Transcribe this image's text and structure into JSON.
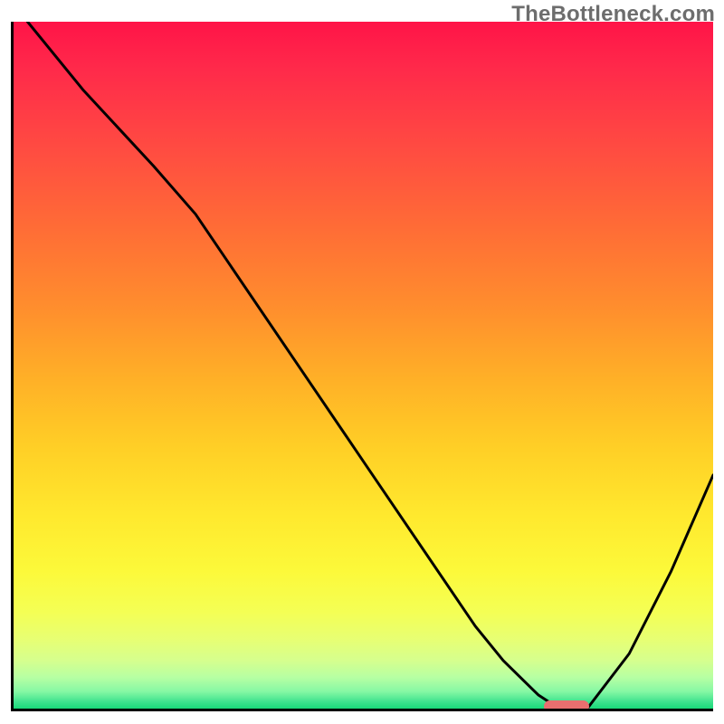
{
  "watermark": "TheBottleneck.com",
  "chart_data": {
    "type": "line",
    "title": "",
    "xlabel": "",
    "ylabel": "",
    "xlim": [
      0,
      100
    ],
    "ylim": [
      0,
      100
    ],
    "grid": false,
    "legend": false,
    "series": [
      {
        "name": "bottleneck-curve",
        "x": [
          2,
          10,
          20,
          26,
          30,
          40,
          50,
          60,
          66,
          70,
          75,
          78,
          82,
          88,
          94,
          100
        ],
        "y": [
          100,
          90,
          79,
          72,
          66,
          51,
          36,
          21,
          12,
          7,
          2,
          0,
          0,
          8,
          20,
          34
        ]
      }
    ],
    "marker": {
      "name": "optimal-range",
      "x_start": 75.5,
      "x_end": 82,
      "y": 0,
      "color": "#e96f6f"
    },
    "gradient": {
      "top": "#ff1448",
      "bottom": "#19d979"
    }
  }
}
